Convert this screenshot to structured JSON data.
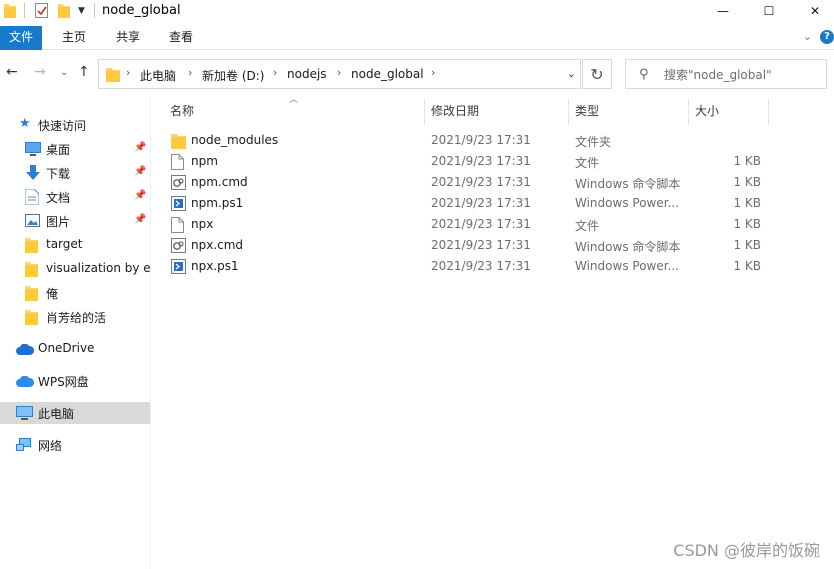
{
  "window": {
    "title": "node_global",
    "controls": {
      "minimize": "—",
      "maximize": "☐",
      "close": "✕"
    }
  },
  "ribbon": {
    "tabs": [
      "文件",
      "主页",
      "共享",
      "查看"
    ],
    "help": "?"
  },
  "address": {
    "breadcrumbs": [
      "此电脑",
      "新加卷 (D:)",
      "nodejs",
      "node_global"
    ]
  },
  "search": {
    "placeholder": "搜索\"node_global\""
  },
  "navigation": {
    "quick_access": "快速访问",
    "pinned": [
      {
        "label": "桌面",
        "icon": "desktop-icon"
      },
      {
        "label": "下载",
        "icon": "download-icon"
      },
      {
        "label": "文档",
        "icon": "documents-icon"
      },
      {
        "label": "图片",
        "icon": "pictures-icon"
      }
    ],
    "folders": [
      "target",
      "visualization by ex",
      "俺",
      "肖芳给的活"
    ],
    "onedrive": "OneDrive",
    "wps": "WPS网盘",
    "this_pc": "此电脑",
    "network": "网络"
  },
  "columns": {
    "name": "名称",
    "date": "修改日期",
    "type": "类型",
    "size": "大小"
  },
  "files": [
    {
      "name": "node_modules",
      "date": "2021/9/23 17:31",
      "type": "文件夹",
      "size": "",
      "icon": "folder"
    },
    {
      "name": "npm",
      "date": "2021/9/23 17:31",
      "type": "文件",
      "size": "1 KB",
      "icon": "file"
    },
    {
      "name": "npm.cmd",
      "date": "2021/9/23 17:31",
      "type": "Windows 命令脚本",
      "size": "1 KB",
      "icon": "cmd"
    },
    {
      "name": "npm.ps1",
      "date": "2021/9/23 17:31",
      "type": "Windows Power...",
      "size": "1 KB",
      "icon": "ps1"
    },
    {
      "name": "npx",
      "date": "2021/9/23 17:31",
      "type": "文件",
      "size": "1 KB",
      "icon": "file"
    },
    {
      "name": "npx.cmd",
      "date": "2021/9/23 17:31",
      "type": "Windows 命令脚本",
      "size": "1 KB",
      "icon": "cmd"
    },
    {
      "name": "npx.ps1",
      "date": "2021/9/23 17:31",
      "type": "Windows Power...",
      "size": "1 KB",
      "icon": "ps1"
    }
  ],
  "watermark": "CSDN @彼岸的饭碗"
}
